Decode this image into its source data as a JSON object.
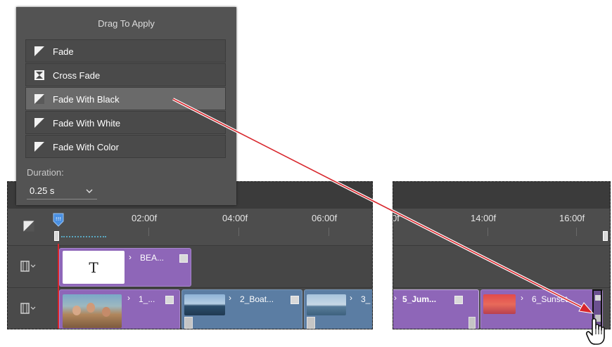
{
  "panel": {
    "title": "Drag To Apply",
    "items": [
      {
        "label": "Fade",
        "icon": "fade-icon"
      },
      {
        "label": "Cross Fade",
        "icon": "cross-fade-icon"
      },
      {
        "label": "Fade With Black",
        "icon": "fade-icon",
        "selected": true
      },
      {
        "label": "Fade With White",
        "icon": "fade-icon"
      },
      {
        "label": "Fade With Color",
        "icon": "fade-icon"
      }
    ],
    "duration_label": "Duration:",
    "duration_value": "0.25 s"
  },
  "timeline_left": {
    "ticks": [
      "02:00f",
      "04:00f",
      "06:00f"
    ],
    "title_clip": {
      "label": "BEA...",
      "thumb_text": "T"
    },
    "video_clips": [
      {
        "label": "1_..."
      },
      {
        "label": "2_Boat..."
      },
      {
        "label": "3_"
      }
    ]
  },
  "timeline_right": {
    "ticks": [
      "0f",
      "14:00f",
      "16:00f"
    ],
    "video_clips": [
      {
        "label": "5_Jum..."
      },
      {
        "label": "6_Sunset"
      }
    ]
  },
  "colors": {
    "arrow": "#d8262c",
    "clip_purple": "#8e66b8",
    "clip_blue": "#5b7da3",
    "playhead": "#4a90e2"
  }
}
